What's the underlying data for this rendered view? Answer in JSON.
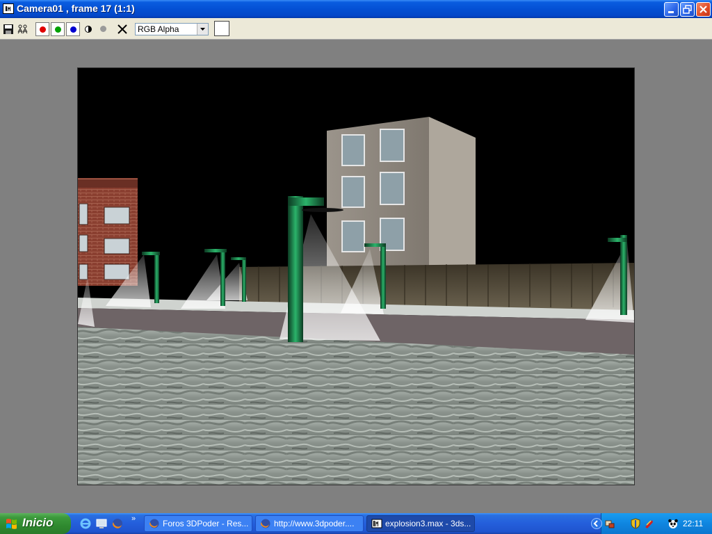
{
  "window": {
    "title": "Camera01 , frame 17 (1:1)",
    "icon": "3dsmax-frame-icon",
    "controls": [
      "minimize-icon",
      "restore-icon",
      "close-icon"
    ]
  },
  "toolbar": {
    "buttons": [
      "save-icon",
      "clone-window-icon",
      "red-channel-icon",
      "green-channel-icon",
      "blue-channel-icon",
      "monochrome-icon",
      "alpha-channel-icon",
      "clear-icon"
    ],
    "channel_select": {
      "value": "RGB Alpha"
    },
    "swatch_color": "#ffffff"
  },
  "render": {
    "description_colors": {
      "sky": "#000000",
      "lamp": "#1e8a52",
      "ground": "#8c9590"
    }
  },
  "taskbar": {
    "start_label": "Inicio",
    "quick_launch": [
      "internet-explorer-icon",
      "desktop-icon",
      "firefox-icon"
    ],
    "more_glyph": "»",
    "tasks": [
      {
        "label": "Foros 3DPoder - Res...",
        "icon": "firefox-icon",
        "active": false
      },
      {
        "label": "http://www.3dpoder....",
        "icon": "firefox-icon",
        "active": false
      },
      {
        "label": "explosion3.max - 3ds...",
        "icon": "3dsmax-icon",
        "active": true
      }
    ],
    "tray_icons": [
      "show-hidden-icon",
      "network-icon",
      "security-shield-icon",
      "antivirus-icon",
      "panda-icon"
    ],
    "clock": "22:11"
  }
}
